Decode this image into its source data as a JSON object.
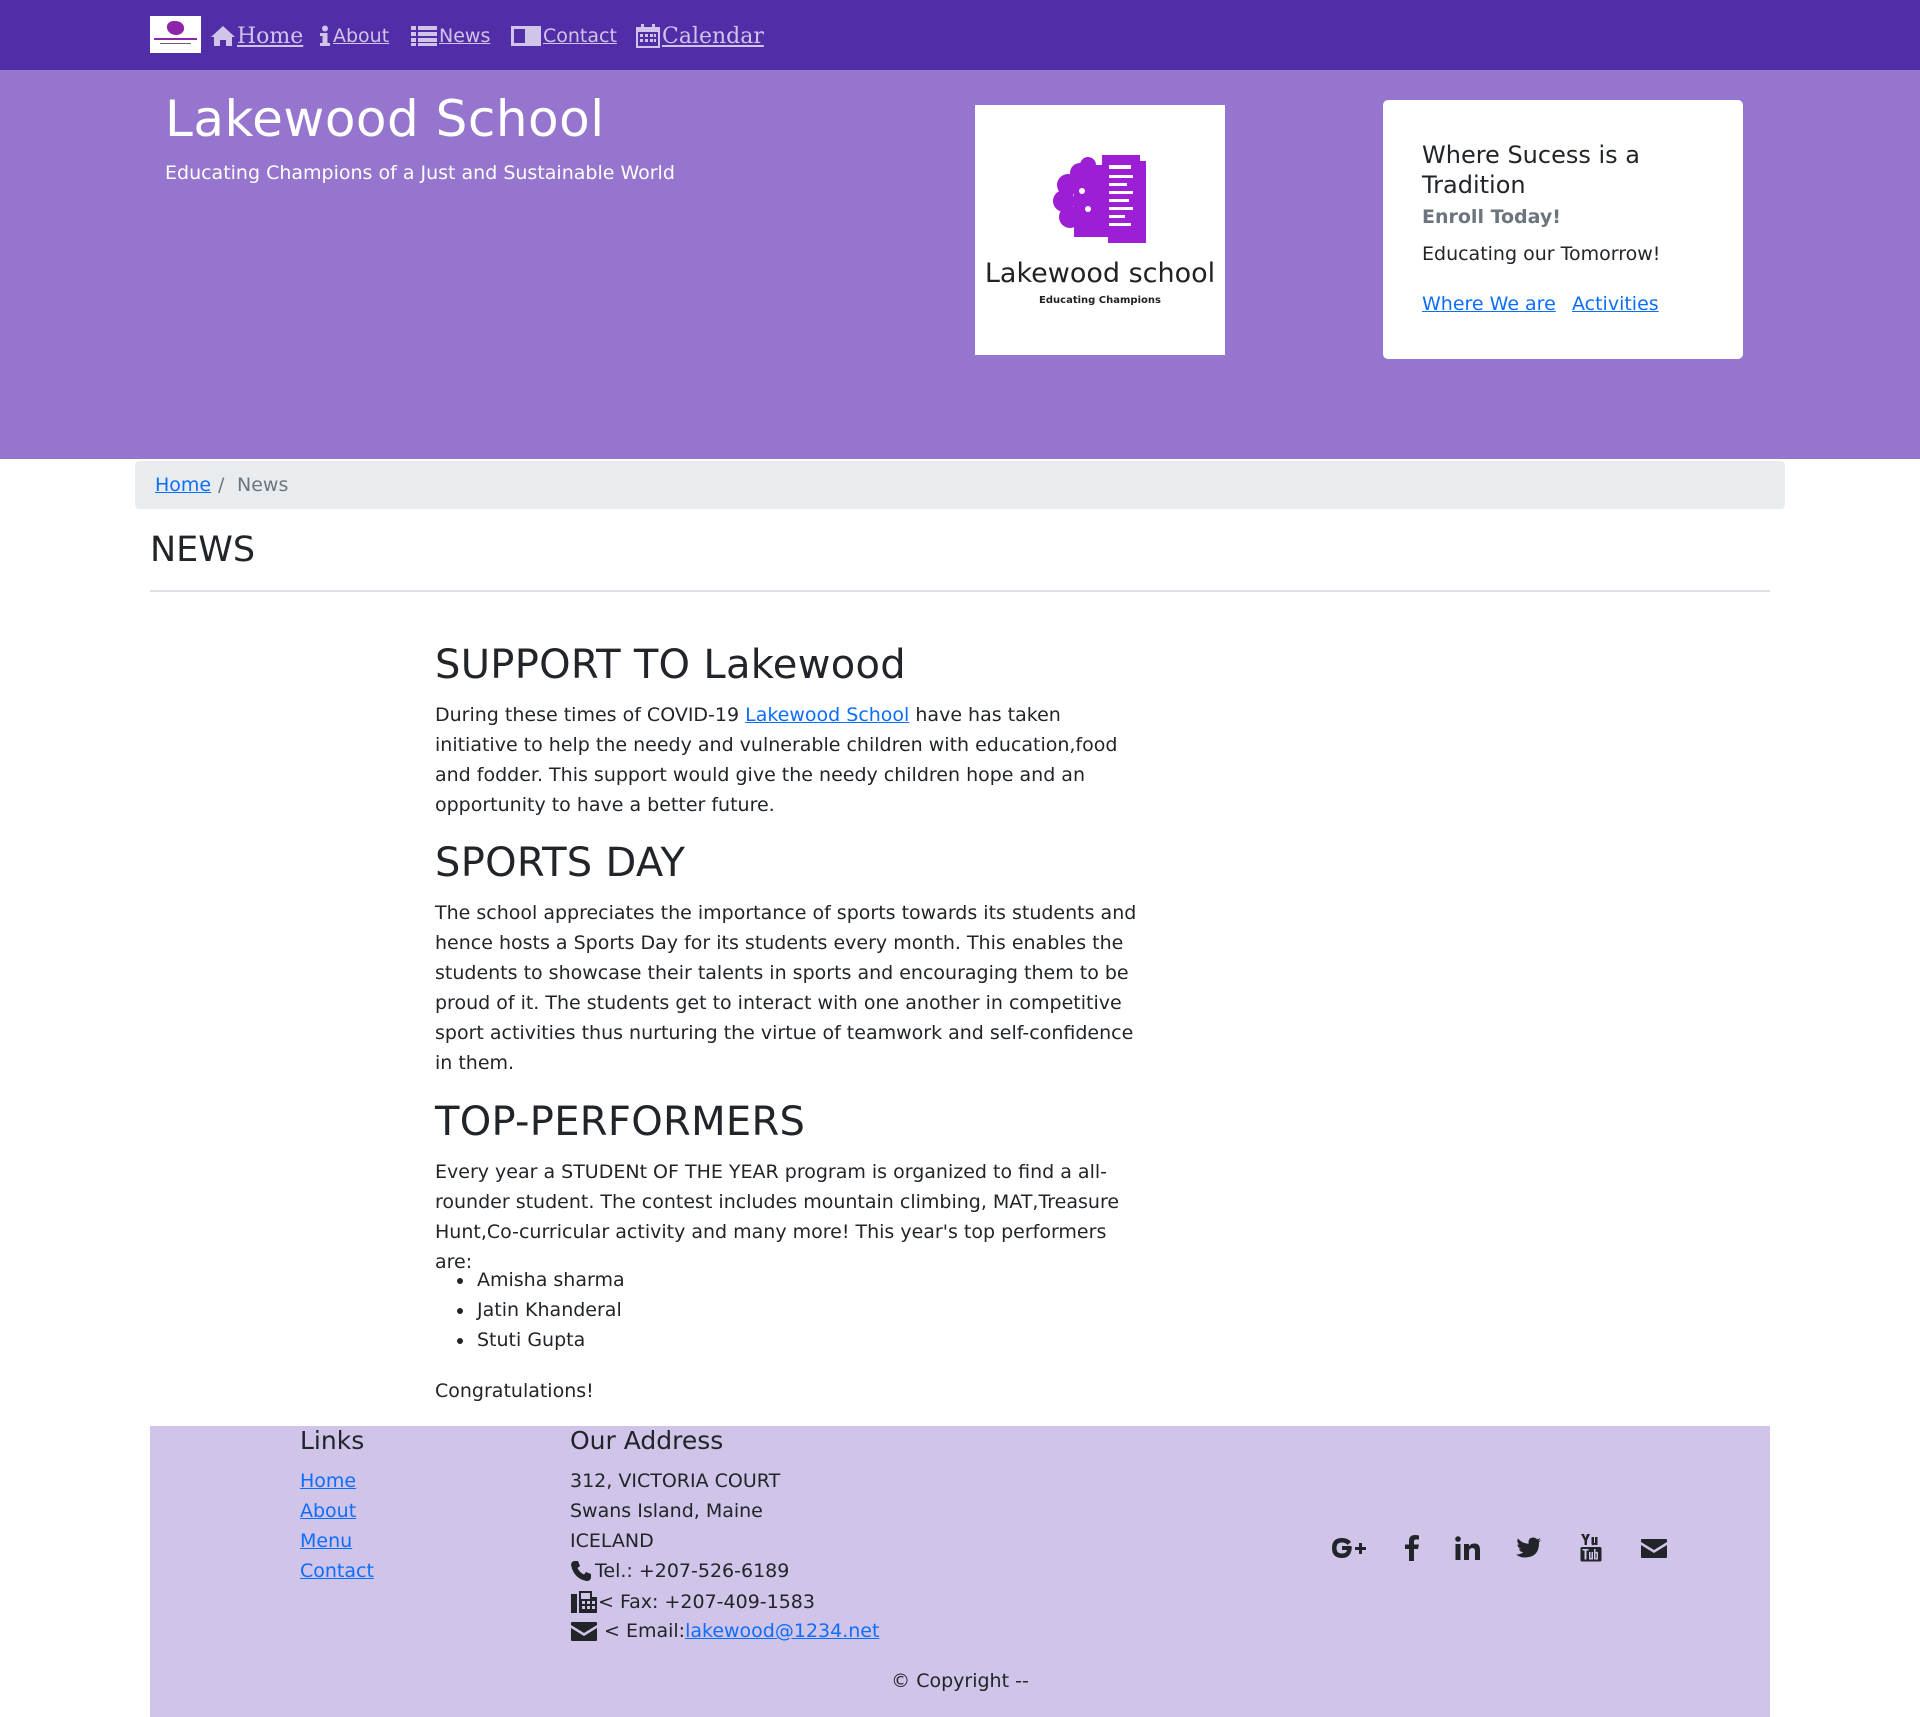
{
  "nav": {
    "items": [
      {
        "label": "Home",
        "icon": "home-icon"
      },
      {
        "label": "About",
        "icon": "info-icon"
      },
      {
        "label": "News",
        "icon": "list-icon"
      },
      {
        "label": "Contact",
        "icon": "address-card-icon"
      },
      {
        "label": "Calendar",
        "icon": "calendar-icon"
      }
    ],
    "text_color": "#d1c4e9",
    "background": "#512da8"
  },
  "hero": {
    "title": "Lakewood School",
    "subtitle": "Educating Champions of a Just and Sustainable World",
    "background": "#9575cd",
    "logo": {
      "name": "Lakewood school",
      "tagline": "Educating Champions"
    },
    "card": {
      "title": "Where Sucess is a Tradition",
      "subtitle": "Enroll Today!",
      "text": "Educating our Tomorrow!",
      "links": [
        "Where We are",
        "Activities"
      ]
    }
  },
  "breadcrumb": {
    "home": "Home",
    "separator": "/",
    "current": "News"
  },
  "page_heading": "NEWS",
  "articles": [
    {
      "title": "SUPPORT TO Lakewood",
      "body_before": "During these times of COVID-19 ",
      "link": "Lakewood School",
      "body_after": " have has taken initiative to help the needy and vulnerable children with education,food and fodder. This support would give the needy children hope and an opportunity to have a better future."
    },
    {
      "title": "SPORTS DAY",
      "body": "The school appreciates the importance of sports towards its students and hence hosts a Sports Day for its students every month. This enables the students to showcase their talents in sports and encouraging them to be proud of it. The students get to interact with one another in competitive sport activities thus nurturing the virtue of teamwork and self-confidence in them."
    },
    {
      "title": "TOP-PERFORMERS",
      "body": "Every year a STUDENt OF THE YEAR program is organized to find a all-rounder student. The contest includes mountain climbing, MAT,Treasure Hunt,Co-curricular activity and many more! This year's top performers are:",
      "performers": [
        "Amisha sharma",
        "Jatin Khanderal",
        "Stuti Gupta"
      ],
      "closing": "Congratulations!"
    }
  ],
  "footer": {
    "links_heading": "Links",
    "links": [
      "Home",
      "About",
      "Menu",
      "Contact"
    ],
    "address_heading": "Our Address",
    "address_lines": [
      "312, VICTORIA COURT",
      "Swans Island, Maine",
      "ICELAND"
    ],
    "tel": "Tel.: +207-526-6189",
    "fax": "< Fax: +207-409-1583",
    "email_label": "< Email: ",
    "email": "lakewood@1234.net",
    "social": [
      "google-plus-icon",
      "facebook-icon",
      "linkedin-icon",
      "twitter-icon",
      "youtube-icon",
      "envelope-icon"
    ],
    "copyright": "© Copyright --",
    "background": "#d1c4e9"
  }
}
